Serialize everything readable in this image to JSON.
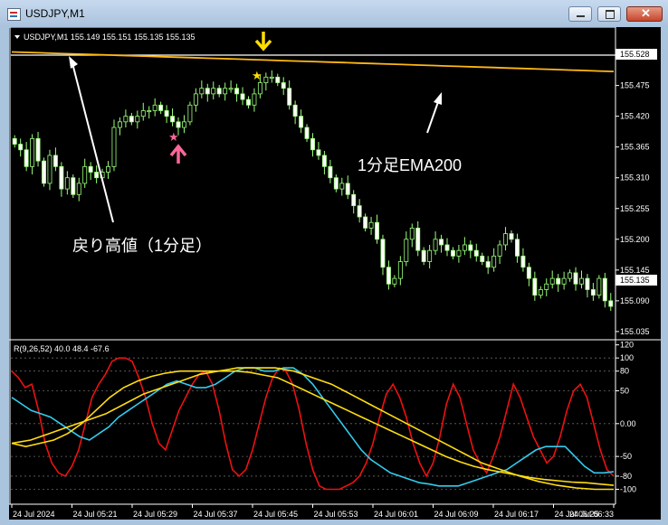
{
  "window": {
    "title": "USDJPY,M1"
  },
  "chart_data": [
    {
      "type": "candlestick",
      "symbol_info": "USDJPY,M1  155.149 155.151 155.135 155.135",
      "y_ticks": [
        "155.528",
        "155.475",
        "155.420",
        "155.365",
        "155.310",
        "155.255",
        "155.200",
        "155.145",
        "155.090",
        "155.035"
      ],
      "price_markers": [
        "155.528",
        "155.135"
      ],
      "ylim": [
        155.03,
        155.56
      ],
      "x_ticks": [
        "24 Jul 2024",
        "24 Jul 05:21",
        "24 Jul 05:29",
        "24 Jul 05:37",
        "24 Jul 05:45",
        "24 Jul 05:53",
        "24 Jul 06:01",
        "24 Jul 06:09",
        "24 Jul 06:17",
        "24 Jul 06:25",
        "24 Jul 06:33"
      ],
      "close": [
        155.37,
        155.36,
        155.33,
        155.38,
        155.34,
        155.3,
        155.35,
        155.33,
        155.29,
        155.31,
        155.28,
        155.3,
        155.33,
        155.32,
        155.31,
        155.32,
        155.33,
        155.4,
        155.41,
        155.42,
        155.41,
        155.42,
        155.43,
        155.43,
        155.44,
        155.43,
        155.42,
        155.41,
        155.4,
        155.41,
        155.44,
        155.46,
        155.47,
        155.46,
        155.47,
        155.46,
        155.47,
        155.47,
        155.46,
        155.45,
        155.44,
        155.46,
        155.48,
        155.49,
        155.49,
        155.48,
        155.47,
        155.44,
        155.42,
        155.4,
        155.38,
        155.36,
        155.35,
        155.33,
        155.31,
        155.29,
        155.3,
        155.28,
        155.26,
        155.24,
        155.22,
        155.23,
        155.2,
        155.15,
        155.12,
        155.13,
        155.16,
        155.2,
        155.22,
        155.18,
        155.16,
        155.18,
        155.2,
        155.19,
        155.18,
        155.17,
        155.18,
        155.19,
        155.18,
        155.17,
        155.16,
        155.15,
        155.17,
        155.19,
        155.21,
        155.2,
        155.17,
        155.15,
        155.13,
        155.1,
        155.11,
        155.12,
        155.13,
        155.12,
        155.13,
        155.14,
        155.12,
        155.13,
        155.11,
        155.1,
        155.13,
        155.09,
        155.08
      ],
      "ema200": [
        155.535,
        155.518,
        155.5
      ],
      "annotations": [
        "戻り高値（1分足）",
        "1分足EMA200"
      ]
    },
    {
      "type": "line",
      "indicator_label": "R(9,26,52) 40.0 48.4 -67.6",
      "y_ticks": [
        "120",
        "100",
        "80",
        "50",
        "0.00",
        "-50",
        "-80",
        "-100"
      ],
      "ylim": [
        -120,
        125
      ],
      "series": [
        {
          "color": "#ee1111",
          "values": [
            80,
            70,
            55,
            60,
            20,
            -30,
            -60,
            -75,
            -80,
            -65,
            -40,
            0,
            40,
            60,
            75,
            95,
            100,
            100,
            95,
            70,
            40,
            0,
            -30,
            -40,
            -10,
            20,
            40,
            60,
            75,
            80,
            60,
            20,
            -30,
            -70,
            -80,
            -70,
            -40,
            0,
            40,
            70,
            85,
            80,
            60,
            20,
            -30,
            -70,
            -95,
            -100,
            -100,
            -100,
            -95,
            -90,
            -80,
            -60,
            -30,
            10,
            45,
            60,
            40,
            10,
            -30,
            -60,
            -80,
            -60,
            -20,
            30,
            60,
            40,
            0,
            -40,
            -60,
            -75,
            -50,
            -20,
            20,
            60,
            40,
            10,
            -20,
            -40,
            -60,
            -50,
            -20,
            20,
            50,
            60,
            40,
            0,
            -40,
            -70,
            -80
          ]
        },
        {
          "color": "#33ccee",
          "values": [
            40,
            30,
            20,
            15,
            10,
            0,
            -10,
            -20,
            -25,
            -15,
            -5,
            10,
            20,
            30,
            40,
            50,
            60,
            65,
            60,
            55,
            55,
            60,
            70,
            80,
            85,
            85,
            80,
            80,
            85,
            85,
            75,
            60,
            40,
            20,
            0,
            -20,
            -40,
            -55,
            -65,
            -75,
            -80,
            -85,
            -90,
            -92,
            -95,
            -95,
            -95,
            -90,
            -85,
            -80,
            -75,
            -70,
            -60,
            -50,
            -40,
            -35,
            -35,
            -35,
            -50,
            -65,
            -75,
            -75,
            -73
          ]
        },
        {
          "color": "#ffdd11",
          "values": [
            -30,
            -35,
            -30,
            -25,
            -15,
            0,
            20,
            40,
            55,
            65,
            72,
            77,
            80,
            80,
            80,
            80,
            80,
            78,
            74,
            70,
            60,
            50,
            40,
            30,
            20,
            10,
            0,
            -10,
            -20,
            -30,
            -40,
            -50,
            -58,
            -65,
            -70,
            -74,
            -78,
            -82,
            -85,
            -87,
            -89,
            -90,
            -92,
            -94
          ]
        },
        {
          "color": "#ffdd11",
          "values": [
            -30,
            -25,
            -15,
            -5,
            5,
            15,
            30,
            45,
            55,
            65,
            75,
            80,
            85,
            85,
            85,
            80,
            70,
            60,
            45,
            30,
            15,
            0,
            -15,
            -30,
            -45,
            -60,
            -70,
            -80,
            -88,
            -94,
            -98,
            -100,
            -100
          ]
        }
      ]
    }
  ]
}
